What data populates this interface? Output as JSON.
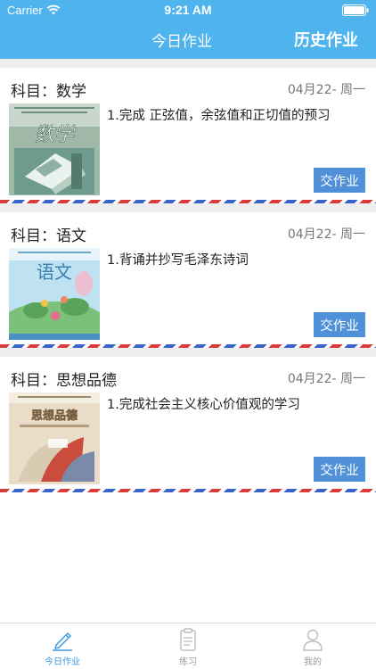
{
  "status_bar": {
    "carrier": "Carrier",
    "time": "9:21 AM"
  },
  "nav": {
    "tab_today": "今日作业",
    "tab_history": "历史作业"
  },
  "colors": {
    "header": "#4fb4ee",
    "submit_button": "#4f90d8",
    "stripe_red": "#d93a3a",
    "stripe_blue": "#3a63c8",
    "tab_active": "#3b9be0"
  },
  "cards": [
    {
      "subject": "科目：数学",
      "date": "04月22- 周一",
      "task": "1.完成 正弦值，余弦值和正切值的预习",
      "submit_label": "交作业",
      "cover_icon": "math-textbook-cover",
      "cover_title": "数学"
    },
    {
      "subject": "科目：语文",
      "date": "04月22- 周一",
      "task": "1.背诵并抄写毛泽东诗词",
      "submit_label": "交作业",
      "cover_icon": "chinese-textbook-cover",
      "cover_title": "语文"
    },
    {
      "subject": "科目：思想品德",
      "date": "04月22- 周一",
      "task": "1.完成社会主义核心价值观的学习",
      "submit_label": "交作业",
      "cover_icon": "ethics-textbook-cover",
      "cover_title": "思想品德"
    }
  ],
  "tabbar": {
    "items": [
      {
        "label": "今日作业",
        "icon": "pencil-icon",
        "active": true
      },
      {
        "label": "练习",
        "icon": "clipboard-icon",
        "active": false
      },
      {
        "label": "我的",
        "icon": "person-icon",
        "active": false
      }
    ]
  }
}
